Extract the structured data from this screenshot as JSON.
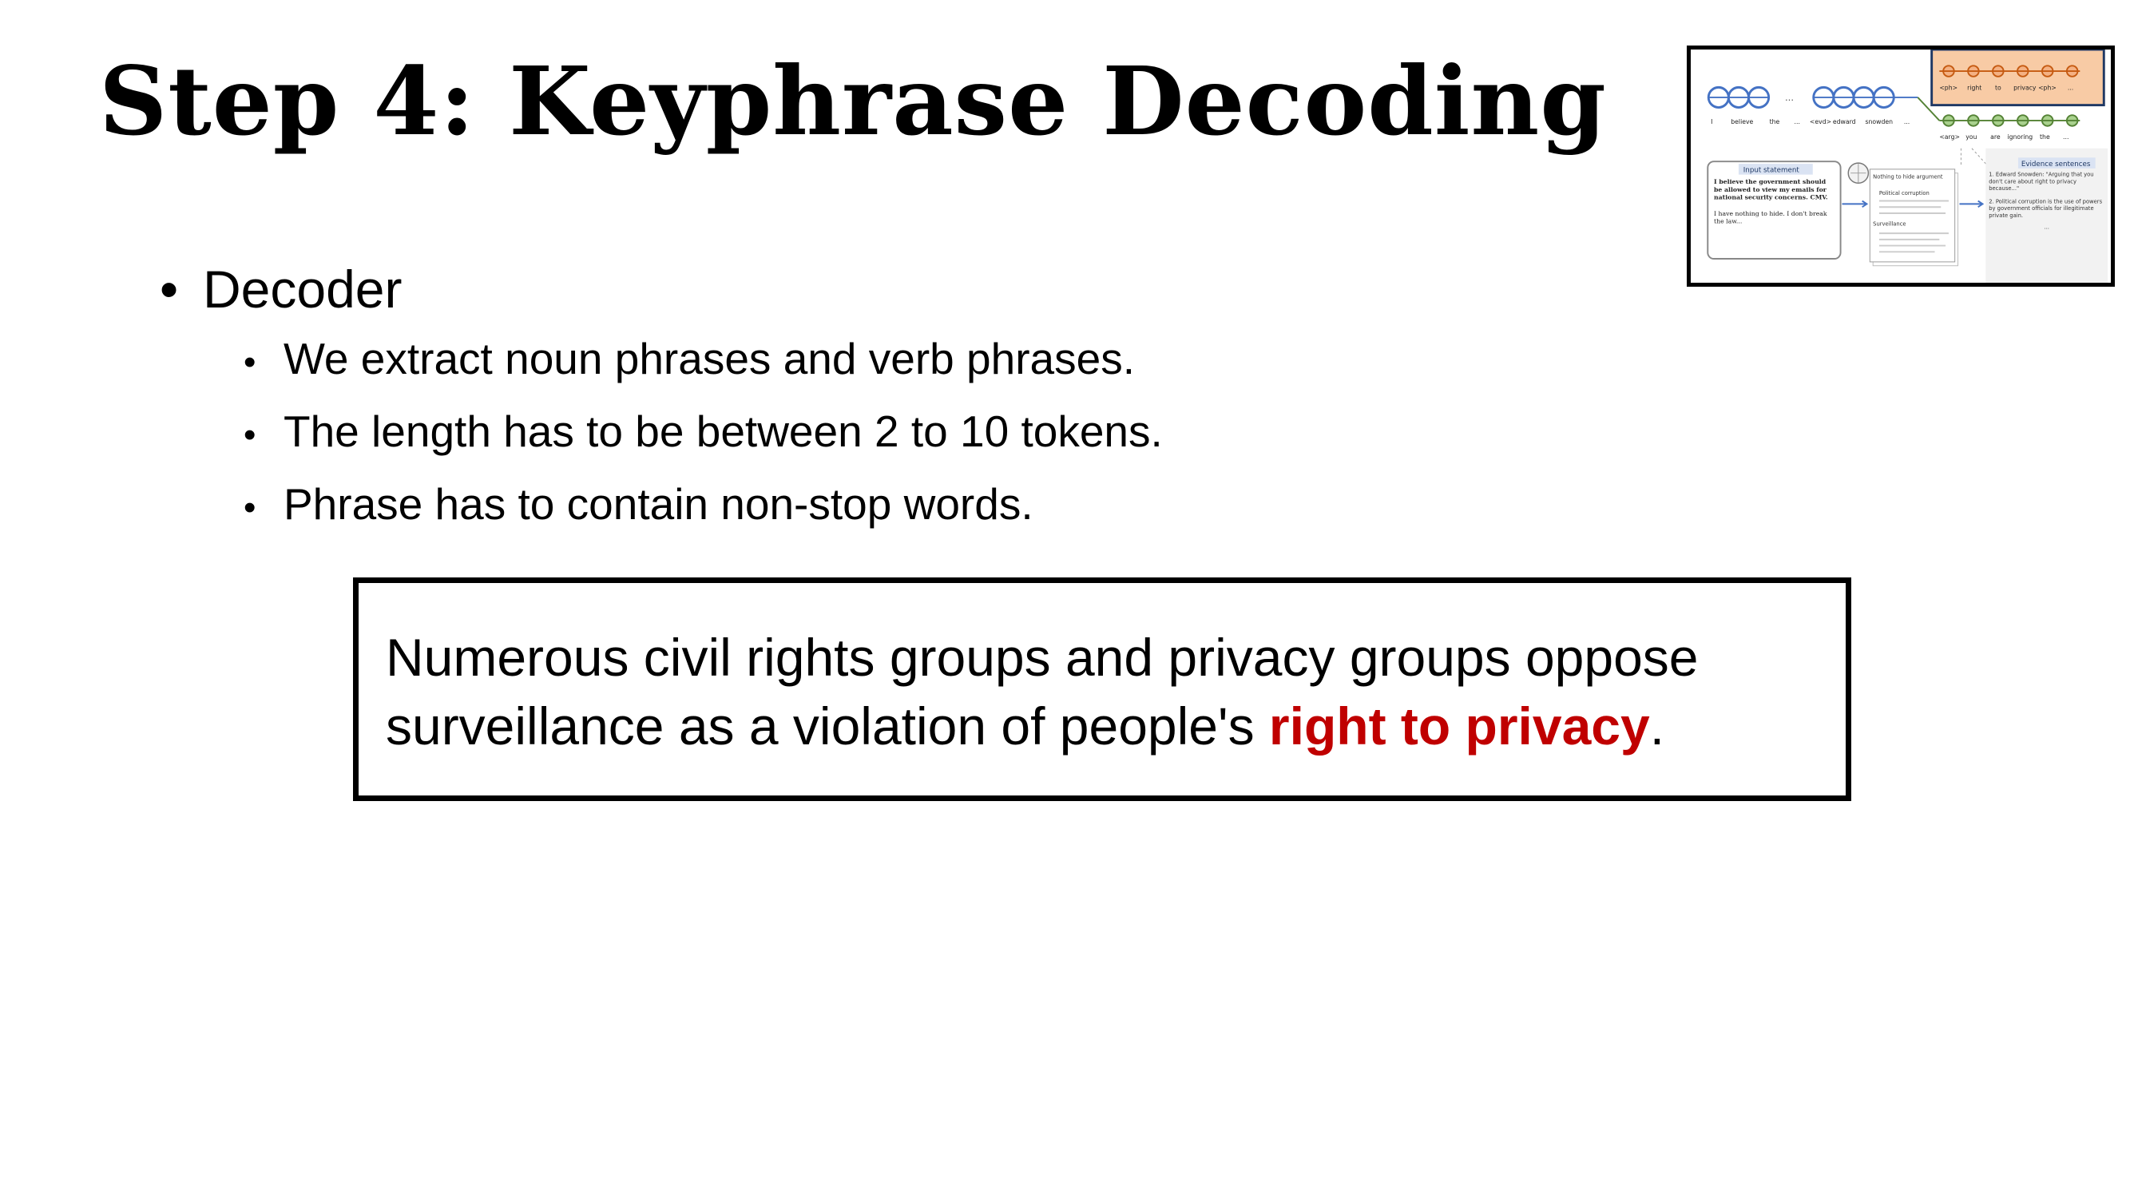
{
  "slide": {
    "title": "Step 4: Keyphrase Decoding",
    "bullet": "Decoder",
    "sub_bullets": [
      "We extract noun phrases and verb phrases.",
      "The length has to be between 2 to 10 tokens.",
      "Phrase has to contain non-stop words."
    ],
    "example": {
      "before": "Numerous civil rights groups and privacy groups oppose surveillance as a violation of people's ",
      "highlight": "right to privacy",
      "after": "."
    },
    "highlight_color": "#c00000"
  },
  "thumbnail": {
    "tokens_top": [
      "I",
      "believe",
      "the",
      "...",
      "<evd>",
      "edward",
      "snowden",
      "..."
    ],
    "tokens_right_top": [
      "<ph>",
      "right",
      "to",
      "privacy",
      "<ph>",
      "..."
    ],
    "tokens_right_bottom": [
      "<arg>",
      "you",
      "are",
      "ignoring",
      "the",
      "..."
    ],
    "input_label": "Input statement",
    "input_text": "I believe the government should be allowed to view my emails for national security concerns. CMV.",
    "input_text_2": "I have nothing to hide. I don't break the law...",
    "wiki_items": [
      "Nothing to hide argument",
      "Political corruption",
      "Surveillance"
    ],
    "evidence_label": "Evidence sentences",
    "evidence_1": "1. Edward Snowden: \"Arguing that you don't care about right to privacy because...\"",
    "evidence_2": "2. Political corruption is the use of powers by government officials for illegitimate private gain.",
    "evidence_more": "..."
  }
}
